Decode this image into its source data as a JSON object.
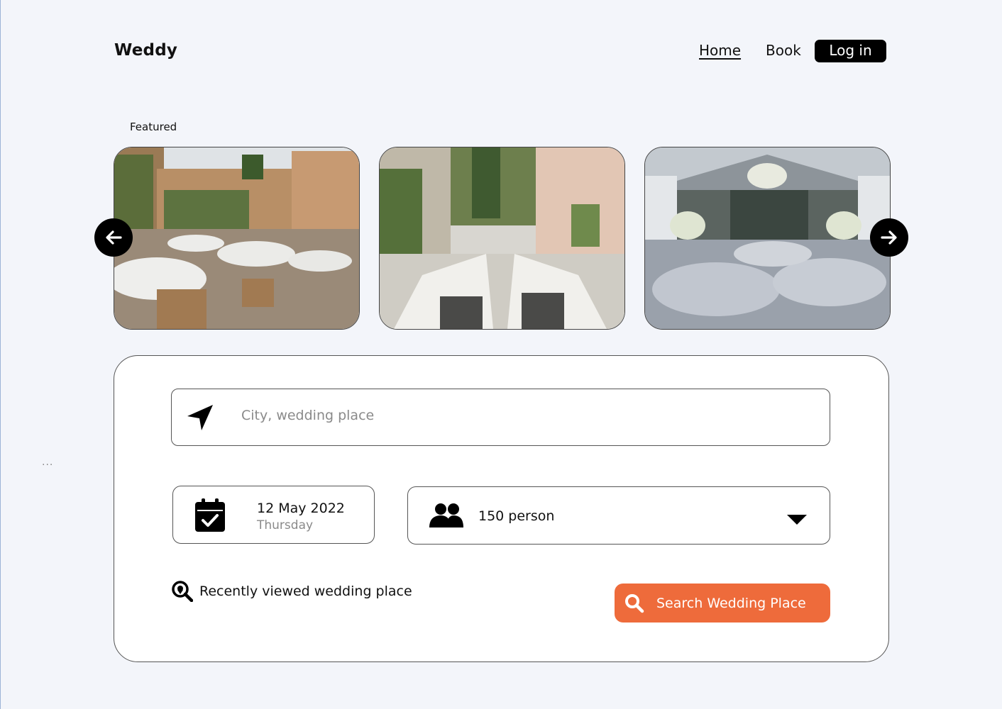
{
  "app": {
    "brand": "Weddy"
  },
  "nav": {
    "home": "Home",
    "book": "Book",
    "login": "Log in"
  },
  "featured": {
    "label": "Featured",
    "cards": [
      {
        "name": "featured-venue-1"
      },
      {
        "name": "featured-venue-2"
      },
      {
        "name": "featured-venue-3"
      }
    ]
  },
  "search": {
    "placeholder": "City, wedding place",
    "date": {
      "value": "12 May 2022",
      "weekday": "Thursday"
    },
    "guests": {
      "value": "150 person"
    },
    "recent_label": "Recently viewed wedding place",
    "button_label": "Search Wedding Place"
  },
  "overflow": {
    "dots": "..."
  },
  "colors": {
    "accent": "#ee6b3b",
    "background": "#f3f5fa",
    "dark": "#000000"
  },
  "icons": [
    "location-arrow-icon",
    "calendar-check-icon",
    "users-icon",
    "caret-down-icon",
    "search-location-icon",
    "search-icon",
    "arrow-left-icon",
    "arrow-right-icon"
  ]
}
